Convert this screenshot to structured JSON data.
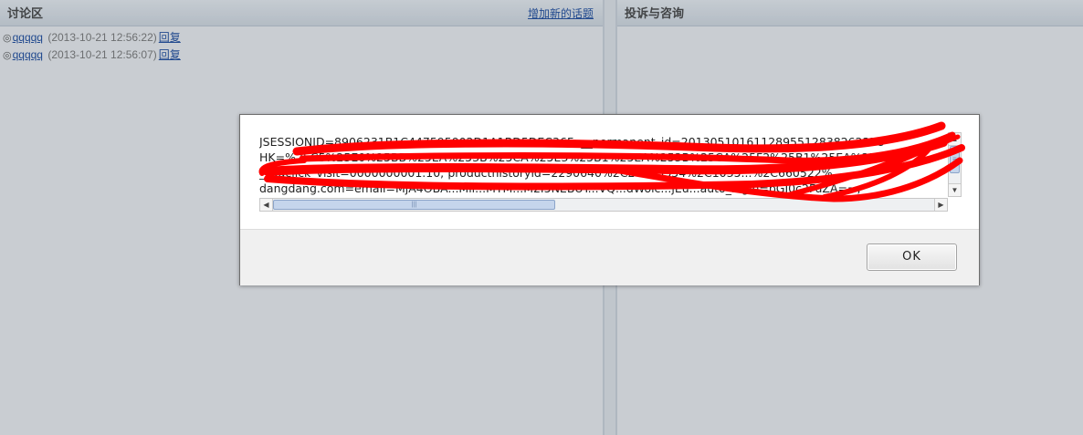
{
  "left_panel": {
    "title": "讨论区",
    "add_topic_link": "增加新的话题",
    "topics": [
      {
        "bullet": "◎",
        "user": "qqqqq",
        "date": "(2013-10-21 12:56:22)",
        "reply": "回复"
      },
      {
        "bullet": "◎",
        "user": "qqqqq",
        "date": "(2013-10-21 12:56:07)",
        "reply": "回复"
      }
    ]
  },
  "right_panel": {
    "title": "投诉与咨询"
  },
  "dialog": {
    "cookie_lines": [
      "JSESSIONID=8906231B1C447595902D1A1BD5DEC36F; __permanent_id=2013051016112895512838262278",
      "HK=%25C5%25E0%25BB%25EA%253B%25CA%25E3%25B1%25EA%253B%25CA%25F2%25B1%25EA%252E",
      "__ddclick_visit=0000000001.10; producthistoryid=2290640%2C20255354%2C1035...%2C660522%",
      "dangdang.com=email=MjA4OBA...Mil...MTM...M2I5NEBUY...VQ...dWolc...jEu...auto_login=bGI0c2FuZA==;"
    ],
    "ok_label": "OK"
  },
  "colors": {
    "scribble": "#ff0000",
    "link": "#1b4a9c",
    "header_text": "#444444"
  }
}
